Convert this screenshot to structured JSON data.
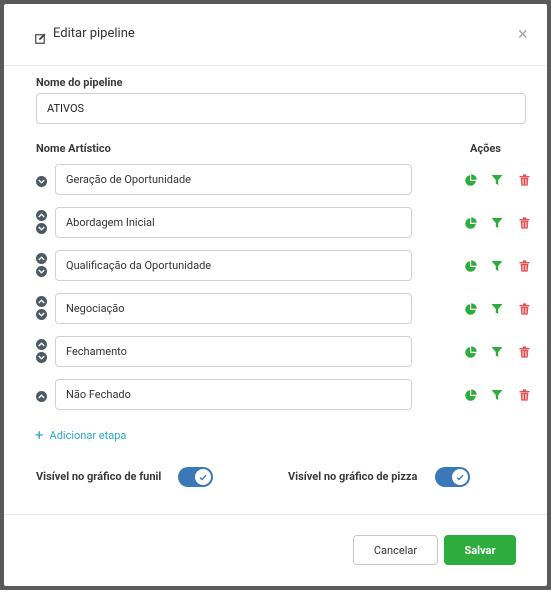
{
  "dialog": {
    "title": "Editar pipeline",
    "close_glyph": "×"
  },
  "form": {
    "pipeline_name_label": "Nome do pipeline",
    "pipeline_name_value": "ATIVOS",
    "stage_column_label": "Nome Artístico",
    "actions_column_label": "Ações"
  },
  "stages": [
    {
      "name": "Geração de Oportunidade",
      "up": false,
      "down": true
    },
    {
      "name": "Abordagem Inicial",
      "up": true,
      "down": true
    },
    {
      "name": "Qualificação da Oportunidade",
      "up": true,
      "down": true
    },
    {
      "name": "Negociação",
      "up": true,
      "down": true
    },
    {
      "name": "Fechamento",
      "up": true,
      "down": true
    },
    {
      "name": "Não Fechado",
      "up": true,
      "down": false
    }
  ],
  "add_stage_label": "Adicionar etapa",
  "toggles": {
    "funnel_label": "Visível no gráfico de funil",
    "funnel_on": true,
    "pie_label": "Visível no gráfico de pizza",
    "pie_on": true
  },
  "buttons": {
    "cancel": "Cancelar",
    "save": "Salvar"
  },
  "icons": {
    "edit": "edit-icon",
    "close": "close-icon",
    "arrow_up": "chevron-up-icon",
    "arrow_down": "chevron-down-icon",
    "pie": "pie-chart-icon",
    "filter": "filter-icon",
    "trash": "trash-icon"
  },
  "colors": {
    "pie_green": "#2eac3e",
    "filter_green": "#2eac3e",
    "trash_red": "#e05252",
    "toggle_blue": "#3a78b8",
    "link_blue": "#2aa6cf",
    "save_green": "#2eac3e"
  }
}
